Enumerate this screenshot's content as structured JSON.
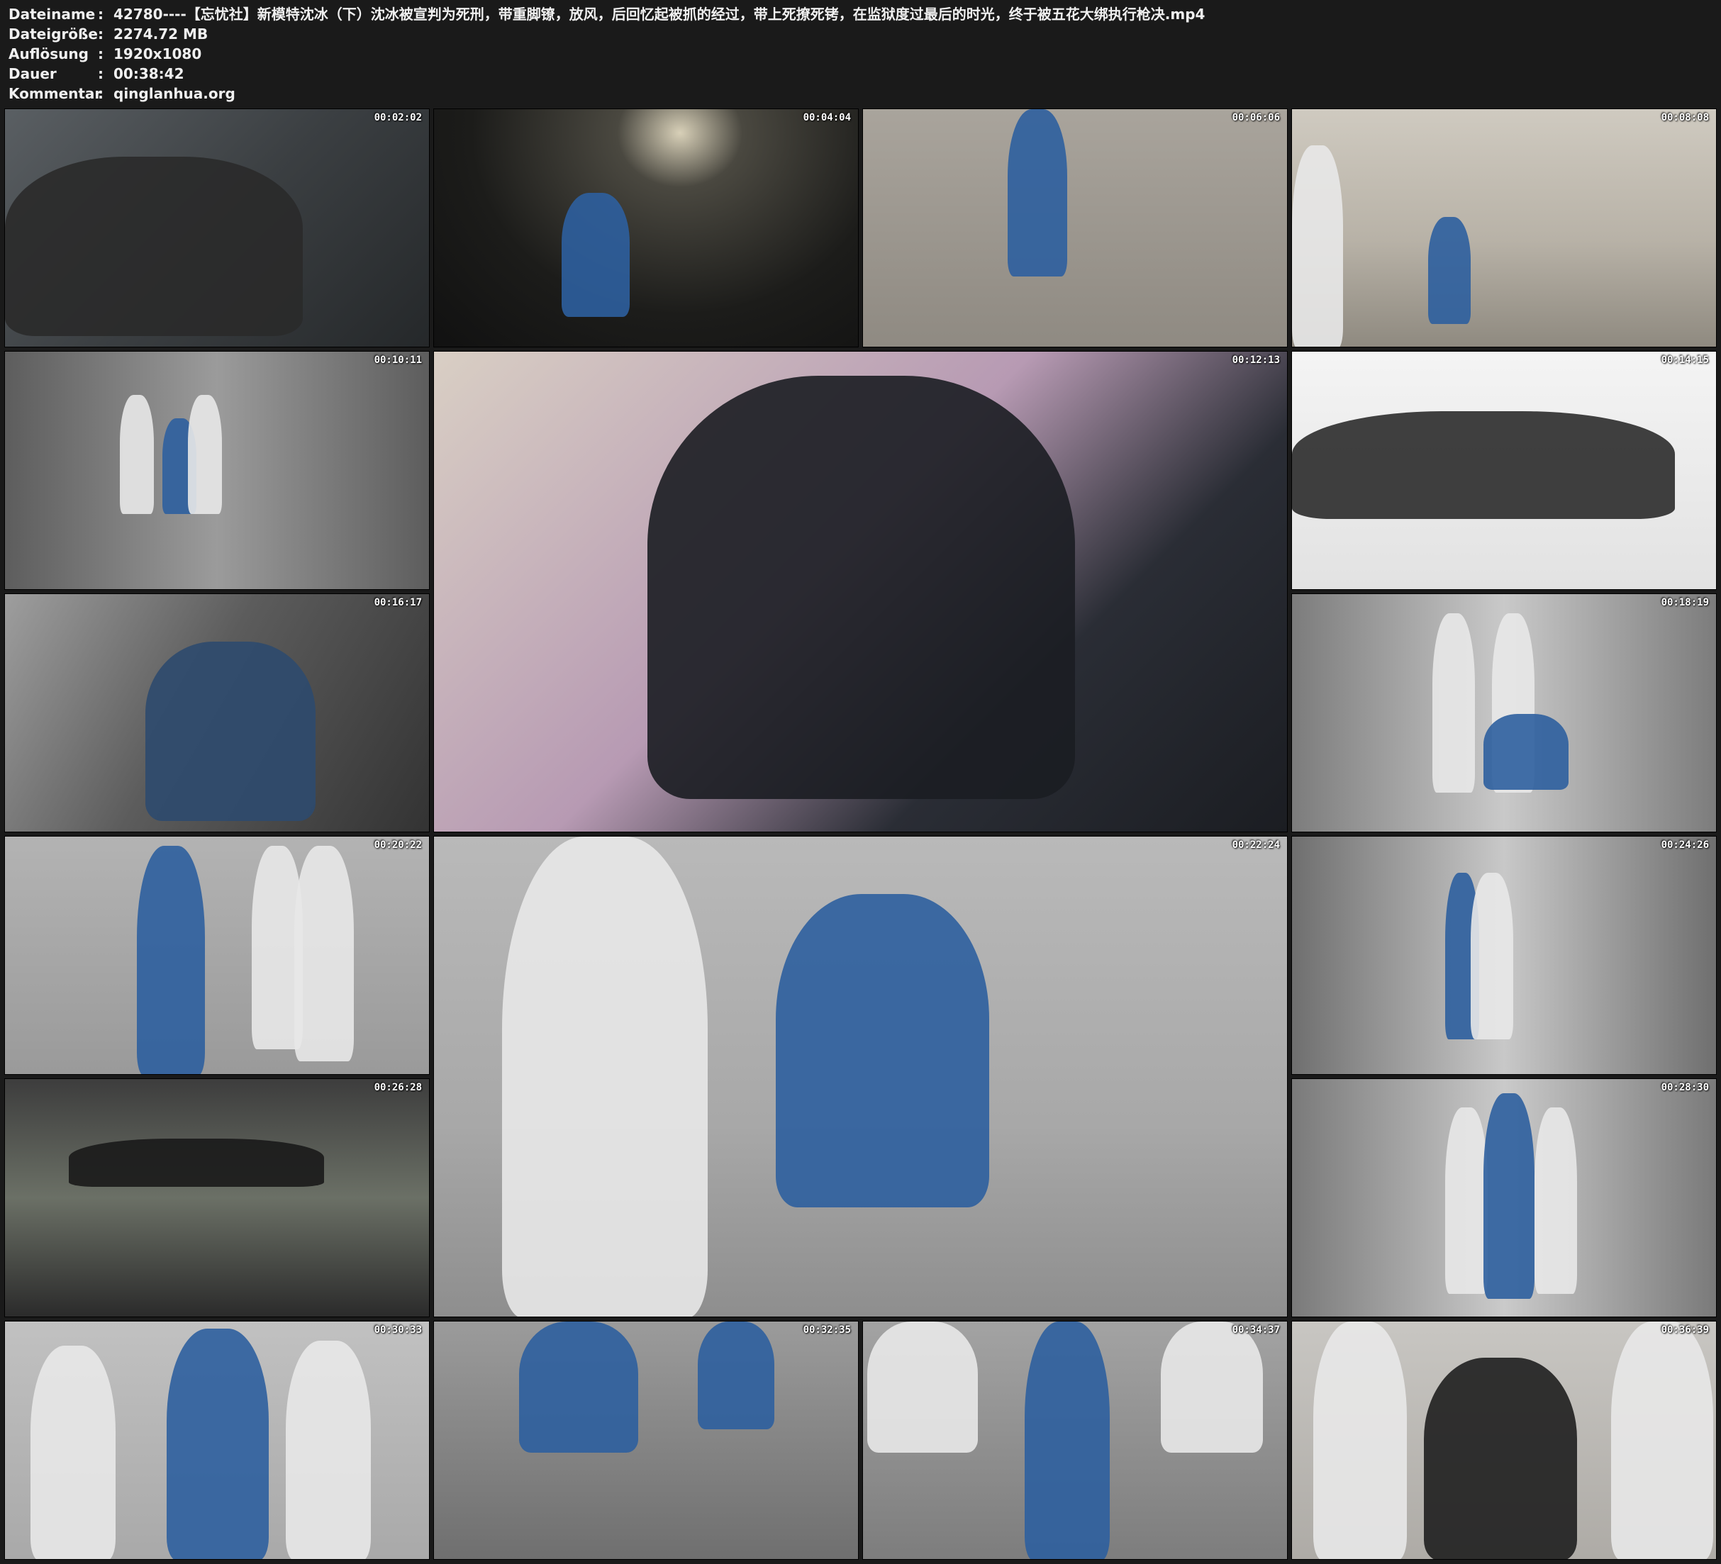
{
  "meta": {
    "rows": [
      {
        "key": "Dateiname",
        "value": "42780----【忘忧社】新模特沈冰（下）沈冰被宣判为死刑，带重脚镣，放风，后回忆起被抓的经过，带上死撩死铐，在监狱度过最后的时光，终于被五花大绑执行枪决.mp4"
      },
      {
        "key": "Dateigröße",
        "value": "2274.72 MB"
      },
      {
        "key": "Auflösung",
        "value": "1920x1080"
      },
      {
        "key": "Dauer",
        "value": "00:38:42"
      },
      {
        "key": "Kommentar",
        "value": "qinglanhua.org"
      }
    ],
    "separator": ":"
  },
  "thumbnails": [
    {
      "timestamp": "00:02:02",
      "scene": "shackled-feet-on-bed"
    },
    {
      "timestamp": "00:04:04",
      "scene": "dark-cell-crouching"
    },
    {
      "timestamp": "00:06:06",
      "scene": "feet-courtyard"
    },
    {
      "timestamp": "00:08:08",
      "scene": "yard-guard"
    },
    {
      "timestamp": "00:10:11",
      "scene": "corridor-escort"
    },
    {
      "timestamp": "00:12:13",
      "scene": "seated-dress"
    },
    {
      "timestamp": "00:14:15",
      "scene": "heels-on-bed"
    },
    {
      "timestamp": "00:16:17",
      "scene": "cell-seated"
    },
    {
      "timestamp": "00:18:19",
      "scene": "corridor-kneeling"
    },
    {
      "timestamp": "00:20:22",
      "scene": "wall-standing"
    },
    {
      "timestamp": "00:22:24",
      "scene": "floor-shackled"
    },
    {
      "timestamp": "00:24:26",
      "scene": "hallway-walk"
    },
    {
      "timestamp": "00:26:28",
      "scene": "lying-on-mat"
    },
    {
      "timestamp": "00:28:30",
      "scene": "three-in-corridor"
    },
    {
      "timestamp": "00:30:33",
      "scene": "three-standing"
    },
    {
      "timestamp": "00:32:35",
      "scene": "chain-closeup"
    },
    {
      "timestamp": "00:34:37",
      "scene": "rope-legs"
    },
    {
      "timestamp": "00:36:39",
      "scene": "head-bowed"
    }
  ],
  "colors": {
    "background": "#1a1a1a",
    "text": "#f0f0f0",
    "uniform_blue": "#2d5f9e",
    "guard_white": "#e8e8e8",
    "skirt_black": "#141414"
  }
}
